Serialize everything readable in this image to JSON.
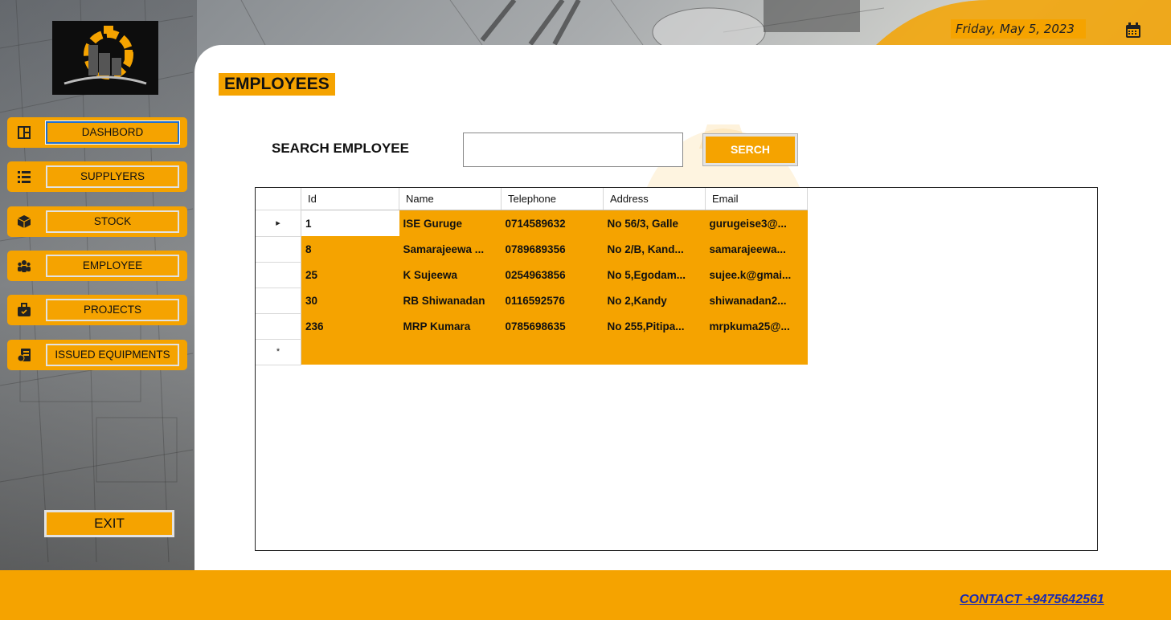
{
  "header": {
    "date": "Friday, May 5, 2023"
  },
  "page": {
    "title": "EMPLOYEES"
  },
  "search": {
    "label": "SEARCH EMPLOYEE",
    "value": "",
    "button_label": "SERCH"
  },
  "sidebar": {
    "items": [
      {
        "label": "DASHBORD",
        "icon": "dashboard-icon",
        "active": true
      },
      {
        "label": "SUPPLYERS",
        "icon": "list-icon"
      },
      {
        "label": "STOCK",
        "icon": "box-icon"
      },
      {
        "label": "EMPLOYEE",
        "icon": "people-icon"
      },
      {
        "label": "PROJECTS",
        "icon": "briefcase-icon"
      },
      {
        "label": "ISSUED EQUIPMENTS",
        "icon": "equipment-icon"
      }
    ],
    "exit_label": "EXIT"
  },
  "table": {
    "columns": [
      "Id",
      "Name",
      "Telephone",
      "Address",
      "Email"
    ],
    "rows": [
      [
        "1",
        "ISE Guruge",
        "0714589632",
        "No 56/3, Galle",
        "gurugeise3@..."
      ],
      [
        "8",
        "Samarajeewa ...",
        "0789689356",
        "No 2/B, Kand...",
        "samarajeewa..."
      ],
      [
        "25",
        "K Sujeewa",
        "0254963856",
        "No 5,Egodam...",
        "sujee.k@gmai..."
      ],
      [
        "30",
        "RB Shiwanadan",
        "0116592576",
        "No 2,Kandy",
        "shiwanadan2..."
      ],
      [
        "236",
        "MRP Kumara",
        "0785698635",
        "No 255,Pitipa...",
        "mrpkuma25@..."
      ]
    ],
    "current_row_marker": "▸",
    "new_row_marker": "*"
  },
  "footer": {
    "contact": "CONTACT +9475642561"
  },
  "colors": {
    "accent": "#f5a300",
    "link": "#1a2ab0"
  }
}
